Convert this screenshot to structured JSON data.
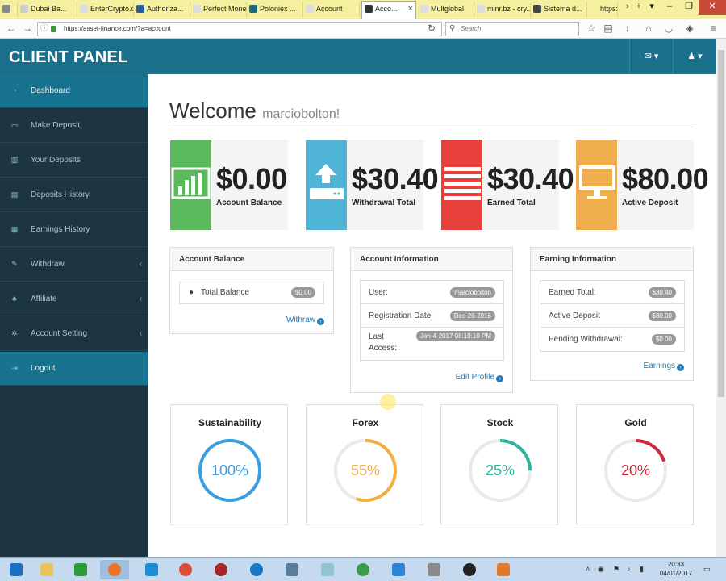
{
  "browser": {
    "tabs": [
      {
        "label": "",
        "fav": "#888"
      },
      {
        "label": "Dubai Ba...",
        "fav": "#ccc"
      },
      {
        "label": "EnterCrypto.c...",
        "fav": "#ddd"
      },
      {
        "label": "Authoriza...",
        "fav": "#2a5d9a"
      },
      {
        "label": "Perfect Mone...",
        "fav": "#ddd"
      },
      {
        "label": "Poloniex ...",
        "fav": "#1e6a73"
      },
      {
        "label": "Account",
        "fav": "#ddd"
      },
      {
        "label": "Acco...",
        "fav": "#333"
      },
      {
        "label": "Multglobal",
        "fav": "#ddd"
      },
      {
        "label": "minr.bz - cry...",
        "fav": "#ddd"
      },
      {
        "label": "Sistema d...",
        "fav": "#444"
      },
      {
        "label": "https://...",
        "fav": "#ddd"
      }
    ],
    "url": "https://asset-finance.com/?a=account",
    "search_placeholder": "Search"
  },
  "app": {
    "brand": "CLIENT PANEL"
  },
  "sidebar": {
    "items": [
      {
        "label": "Dashboard",
        "icon": "dashboard-icon",
        "glyph": "◔"
      },
      {
        "label": "Make Deposit",
        "icon": "monitor-icon",
        "glyph": "▭"
      },
      {
        "label": "Your Deposits",
        "icon": "chart-icon",
        "glyph": "▥"
      },
      {
        "label": "Deposits History",
        "icon": "list-icon",
        "glyph": "▤"
      },
      {
        "label": "Earnings History",
        "icon": "table-icon",
        "glyph": "▦"
      },
      {
        "label": "Withdraw",
        "icon": "edit-icon",
        "glyph": "✎"
      },
      {
        "label": "Affiliate",
        "icon": "sitemap-icon",
        "glyph": "♣"
      },
      {
        "label": "Account Setting",
        "icon": "gear-icon",
        "glyph": "✲"
      },
      {
        "label": "Logout",
        "icon": "logout-icon",
        "glyph": "⇥"
      }
    ]
  },
  "welcome": {
    "title": "Welcome",
    "username": "marciobolton!"
  },
  "stats": [
    {
      "amount": "$0.00",
      "label": "Account Balance",
      "color": "#5cb85c",
      "icon": "bar-chart-icon"
    },
    {
      "amount": "$30.40",
      "label": "Withdrawal Total",
      "color": "#4fb4d6",
      "icon": "upload-icon"
    },
    {
      "amount": "$30.40",
      "label": "Earned Total",
      "color": "#e8403a",
      "icon": "list-lines-icon"
    },
    {
      "amount": "$80.00",
      "label": "Active Deposit",
      "color": "#f0ad4e",
      "icon": "desktop-icon"
    }
  ],
  "panels": {
    "balance": {
      "title": "Account Balance",
      "row_label": "Total Balance",
      "row_value": "$0.00",
      "link": "Withraw"
    },
    "info": {
      "title": "Account Information",
      "rows": [
        {
          "label": "User:",
          "value": "marciobolton"
        },
        {
          "label": "Registration Date:",
          "value": "Dec-26-2016"
        },
        {
          "label": "Last",
          "label2": "Access:",
          "value": "Jan-4-2017 08:19:10 PM"
        }
      ],
      "link": "Edit Profile"
    },
    "earning": {
      "title": "Earning Information",
      "rows": [
        {
          "label": "Earned Total:",
          "value": "$30.40"
        },
        {
          "label": "Active Deposit",
          "value": "$80.00"
        },
        {
          "label": "Pending Withdrawal:",
          "value": "$0.00"
        }
      ],
      "link": "Earnings"
    }
  },
  "gauges": [
    {
      "title": "Sustainability",
      "value": "100%",
      "fraction": 1.0,
      "color": "#3a9ee0"
    },
    {
      "title": "Forex",
      "value": "55%",
      "fraction": 0.55,
      "color": "#f0b040"
    },
    {
      "title": "Stock",
      "value": "25%",
      "fraction": 0.25,
      "color": "#2ab6a0"
    },
    {
      "title": "Gold",
      "value": "20%",
      "fraction": 0.2,
      "color": "#d0283c"
    }
  ],
  "taskbar": {
    "time": "20:33",
    "date": "04/01/2017"
  }
}
